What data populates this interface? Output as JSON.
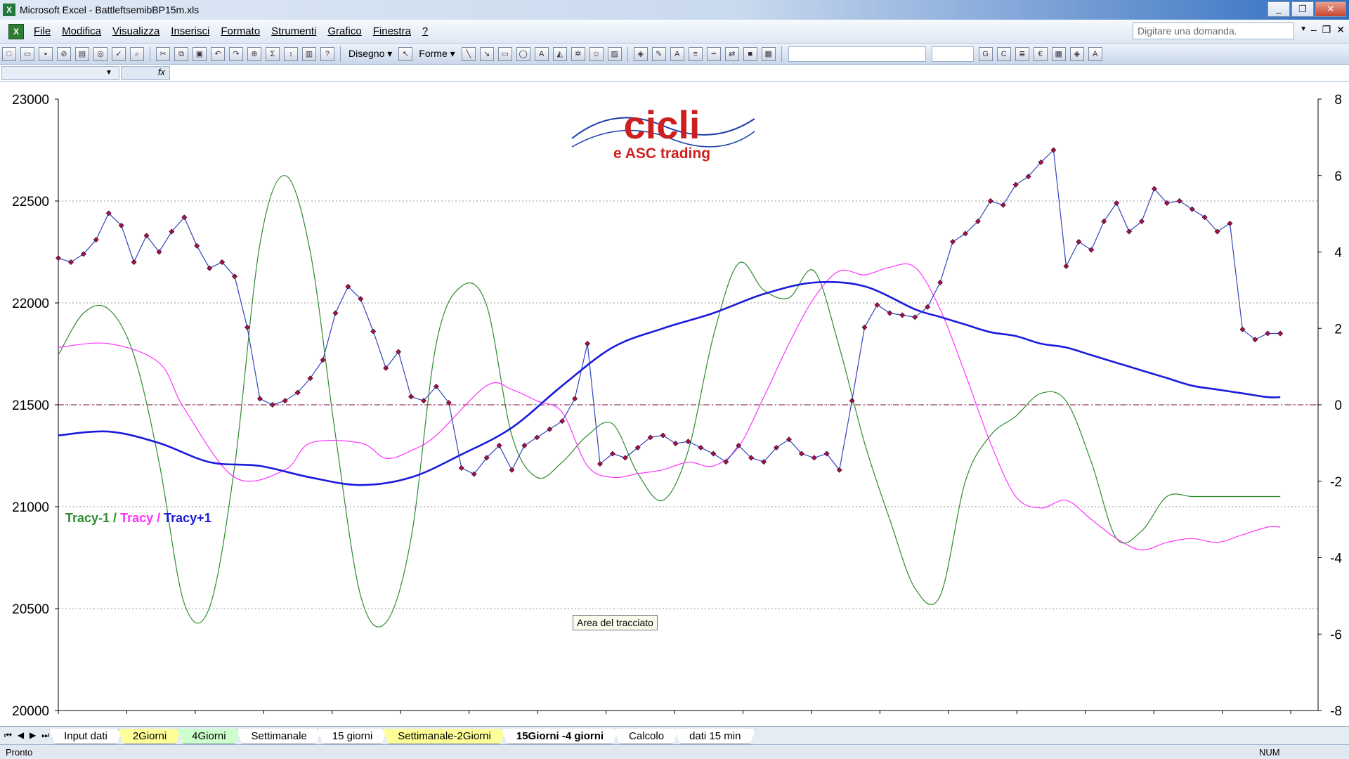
{
  "window": {
    "app": "Microsoft Excel",
    "file": "BattleftsemibBP15m.xls",
    "title": "Microsoft Excel - BattleftsemibBP15m.xls"
  },
  "window_buttons": {
    "minimize": "_",
    "restore": "❐",
    "close": "✕"
  },
  "menu": {
    "items": [
      "File",
      "Modifica",
      "Visualizza",
      "Inserisci",
      "Formato",
      "Strumenti",
      "Grafico",
      "Finestra",
      "?"
    ],
    "ask_placeholder": "Digitare una domanda.",
    "mdi_buttons": [
      "–",
      "❐",
      "✕"
    ]
  },
  "toolbar": {
    "disegno": "Disegno ▾",
    "forme": "Forme ▾",
    "bold": "G",
    "italic": "C",
    "euro": "€"
  },
  "formula_bar": {
    "fx": "fx"
  },
  "logo": {
    "text_main": "cicli",
    "text_sub": "e ASC trading"
  },
  "legend": {
    "tracy_minus_1": "Tracy-1",
    "sep1": " / ",
    "tracy": "Tracy",
    "sep2": " / ",
    "tracy_plus_1": "Tracy+1"
  },
  "tooltip": "Area del tracciato",
  "tabs": {
    "nav": [
      "⏮",
      "◀",
      "▶",
      "⏭"
    ],
    "items": [
      {
        "label": "Input dati",
        "style": "normal"
      },
      {
        "label": "2Giorni",
        "style": "yellow"
      },
      {
        "label": "4Giorni",
        "style": "green"
      },
      {
        "label": "Settimanale",
        "style": "normal"
      },
      {
        "label": "15 giorni",
        "style": "normal"
      },
      {
        "label": "Settimanale-2Giorni",
        "style": "yellow"
      },
      {
        "label": "15Giorni -4 giorni",
        "style": "active"
      },
      {
        "label": "Calcolo",
        "style": "normal"
      },
      {
        "label": "dati 15 min",
        "style": "normal"
      }
    ]
  },
  "status": {
    "left": "Pronto",
    "num": "NUM"
  },
  "colors": {
    "price": "#3344bb",
    "price_markers": "#aa1144",
    "tracy_minus_1": "#2e8b2e",
    "tracy": "#ff33ff",
    "tracy_plus_1": "#1a1adc",
    "zero_line": "#993366",
    "logo_red": "#cc2020"
  },
  "chart_data": {
    "type": "line",
    "left_axis": {
      "min": 20000,
      "max": 23000,
      "ticks": [
        20000,
        20500,
        21000,
        21500,
        22000,
        22500,
        23000
      ]
    },
    "right_axis": {
      "min": -8,
      "max": 8,
      "ticks": [
        -8,
        -6,
        -4,
        -2,
        0,
        2,
        4,
        6,
        8
      ]
    },
    "x_range": [
      0,
      100
    ],
    "zero_line": 0,
    "grid": "horizontal dotted",
    "series": [
      {
        "key": "price",
        "axis": "left",
        "markers": true,
        "x": [
          0,
          1,
          2,
          3,
          4,
          5,
          6,
          7,
          8,
          9,
          10,
          11,
          12,
          13,
          14,
          15,
          16,
          17,
          18,
          19,
          20,
          21,
          22,
          23,
          24,
          25,
          26,
          27,
          28,
          29,
          30,
          31,
          32,
          33,
          34,
          35,
          36,
          37,
          38,
          39,
          40,
          41,
          42,
          43,
          44,
          45,
          46,
          47,
          48,
          49,
          50,
          51,
          52,
          53,
          54,
          55,
          56,
          57,
          58,
          59,
          60,
          61,
          62,
          63,
          64,
          65,
          66,
          67,
          68,
          69,
          70,
          71,
          72,
          73,
          74,
          75,
          76,
          77,
          78,
          79,
          80,
          81,
          82,
          83,
          84,
          85,
          86,
          87,
          88,
          89,
          90,
          91,
          92,
          93,
          94,
          95,
          96,
          97
        ],
        "values": [
          22220,
          22200,
          22240,
          22310,
          22440,
          22380,
          22200,
          22330,
          22250,
          22350,
          22420,
          22280,
          22170,
          22200,
          22130,
          21880,
          21530,
          21500,
          21520,
          21560,
          21630,
          21720,
          21950,
          22080,
          22020,
          21860,
          21680,
          21760,
          21540,
          21520,
          21590,
          21510,
          21190,
          21160,
          21240,
          21300,
          21180,
          21300,
          21340,
          21380,
          21420,
          21530,
          21800,
          21210,
          21260,
          21240,
          21290,
          21340,
          21350,
          21310,
          21320,
          21290,
          21260,
          21220,
          21300,
          21240,
          21220,
          21290,
          21330,
          21260,
          21240,
          21260,
          21180,
          21520,
          21880,
          21990,
          21950,
          21940,
          21930,
          21980,
          22100,
          22300,
          22340,
          22400,
          22500,
          22480,
          22580,
          22620,
          22690,
          22750,
          22180,
          22300,
          22260,
          22400,
          22490,
          22350,
          22400,
          22560,
          22490,
          22500,
          22460,
          22420,
          22350,
          22390,
          21870,
          21820,
          21850,
          21850
        ]
      },
      {
        "key": "tracy_minus_1",
        "axis": "right",
        "x": [
          0,
          2,
          4,
          6,
          8,
          10,
          12,
          14,
          16,
          18,
          20,
          22,
          24,
          26,
          28,
          30,
          32,
          34,
          36,
          38,
          40,
          42,
          44,
          46,
          48,
          50,
          52,
          54,
          56,
          58,
          60,
          62,
          64,
          66,
          68,
          70,
          72,
          74,
          76,
          78,
          80,
          82,
          84,
          86,
          88,
          90,
          92,
          94,
          96,
          97
        ],
        "values": [
          1.3,
          2.4,
          2.5,
          1.3,
          -1.5,
          -5.2,
          -5.3,
          -1.6,
          4.2,
          6.0,
          4.0,
          -0.8,
          -5.0,
          -5.7,
          -3.5,
          1.6,
          3.1,
          2.6,
          -0.8,
          -1.9,
          -1.5,
          -0.8,
          -0.5,
          -1.8,
          -2.5,
          -1.2,
          1.8,
          3.7,
          3.0,
          2.8,
          3.5,
          1.5,
          -1.0,
          -3.0,
          -4.8,
          -5.0,
          -2.0,
          -0.8,
          -0.3,
          0.3,
          0.1,
          -1.5,
          -3.5,
          -3.3,
          -2.4,
          -2.4,
          -2.4,
          -2.4,
          -2.4,
          -2.4
        ]
      },
      {
        "key": "tracy",
        "axis": "right",
        "x": [
          0,
          4,
          8,
          10,
          14,
          18,
          20,
          24,
          26,
          28,
          30,
          34,
          36,
          38,
          40,
          42,
          44,
          46,
          48,
          50,
          52,
          54,
          56,
          58,
          60,
          62,
          64,
          66,
          68,
          70,
          72,
          74,
          76,
          78,
          80,
          82,
          84,
          86,
          88,
          90,
          92,
          94,
          96,
          97
        ],
        "values": [
          1.5,
          1.6,
          1.1,
          -0.1,
          -1.9,
          -1.7,
          -1.0,
          -1.0,
          -1.4,
          -1.2,
          -0.8,
          0.5,
          0.4,
          0.1,
          -0.2,
          -1.6,
          -1.9,
          -1.8,
          -1.7,
          -1.5,
          -1.6,
          -1.1,
          0.2,
          1.6,
          2.8,
          3.5,
          3.4,
          3.6,
          3.6,
          2.5,
          0.8,
          -1.0,
          -2.4,
          -2.7,
          -2.5,
          -3.0,
          -3.5,
          -3.8,
          -3.6,
          -3.5,
          -3.6,
          -3.4,
          -3.2,
          -3.2
        ]
      },
      {
        "key": "tracy_plus_1",
        "axis": "right",
        "x": [
          0,
          4,
          8,
          12,
          16,
          20,
          24,
          28,
          32,
          36,
          40,
          44,
          48,
          52,
          56,
          60,
          64,
          68,
          70,
          72,
          74,
          76,
          78,
          80,
          82,
          84,
          86,
          88,
          90,
          92,
          94,
          96,
          97
        ],
        "values": [
          -0.8,
          -0.7,
          -1.0,
          -1.5,
          -1.6,
          -1.9,
          -2.1,
          -1.9,
          -1.3,
          -0.6,
          0.5,
          1.5,
          2.0,
          2.4,
          2.9,
          3.2,
          3.1,
          2.5,
          2.3,
          2.1,
          1.9,
          1.8,
          1.6,
          1.5,
          1.3,
          1.1,
          0.9,
          0.7,
          0.5,
          0.4,
          0.3,
          0.2,
          0.2
        ]
      }
    ]
  }
}
